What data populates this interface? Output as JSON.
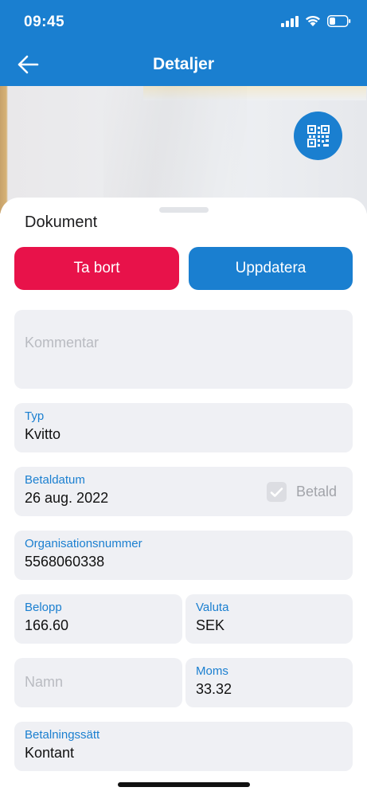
{
  "status_bar": {
    "time": "09:45"
  },
  "nav": {
    "title": "Detaljer"
  },
  "sheet": {
    "title": "Dokument",
    "delete_label": "Ta bort",
    "update_label": "Uppdatera"
  },
  "form": {
    "comment": {
      "placeholder": "Kommentar",
      "value": ""
    },
    "type": {
      "label": "Typ",
      "value": "Kvitto"
    },
    "payment_date": {
      "label": "Betaldatum",
      "value": "26 aug. 2022"
    },
    "paid": {
      "label": "Betald",
      "checked": true
    },
    "org_number": {
      "label": "Organisationsnummer",
      "value": "5568060338"
    },
    "amount": {
      "label": "Belopp",
      "value": "166.60"
    },
    "currency": {
      "label": "Valuta",
      "value": "SEK"
    },
    "name": {
      "placeholder": "Namn",
      "value": ""
    },
    "vat": {
      "label": "Moms",
      "value": "33.32"
    },
    "payment_method": {
      "label": "Betalningssätt",
      "value": "Kontant"
    }
  },
  "colors": {
    "primary": "#1a7fd0",
    "danger": "#e8124a",
    "field_bg": "#eff0f4"
  }
}
